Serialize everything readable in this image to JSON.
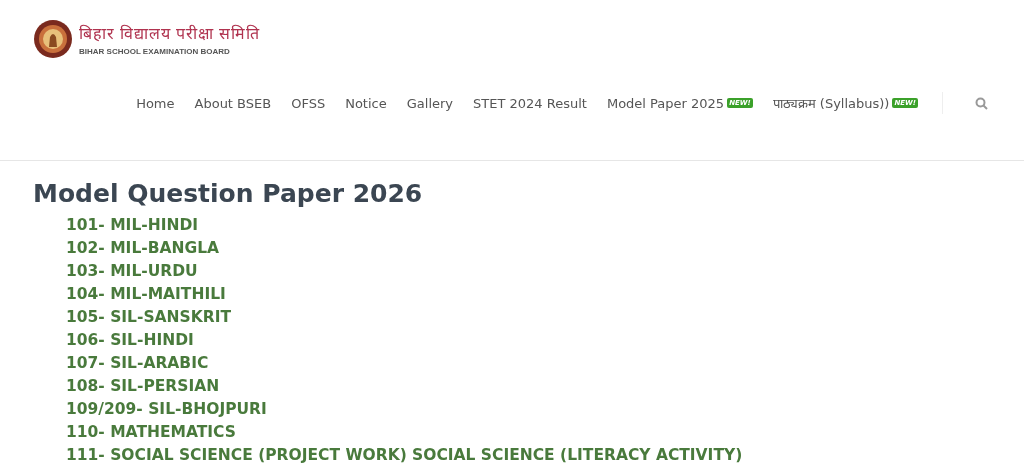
{
  "logo": {
    "title": "बिहार विद्यालय परीक्षा समिति",
    "subtitle": "BIHAR SCHOOL EXAMINATION BOARD"
  },
  "nav": [
    {
      "label": "Home"
    },
    {
      "label": "About BSEB"
    },
    {
      "label": "OFSS"
    },
    {
      "label": "Notice"
    },
    {
      "label": "Gallery"
    },
    {
      "label": "STET 2024 Result"
    },
    {
      "label": "Model Paper 2025",
      "badge": "NEW!"
    },
    {
      "label": "पाठ्यक्रम (Syllabus))",
      "badge": "NEW!"
    }
  ],
  "heading": "Model Question Paper 2026",
  "papers": [
    "101- MIL-HINDI",
    "102- MIL-BANGLA",
    "103- MIL-URDU",
    "104- MIL-MAITHILI",
    "105- SIL-SANSKRIT",
    "106- SIL-HINDI",
    "107- SIL-ARABIC",
    "108- SIL-PERSIAN",
    "109/209- SIL-BHOJPURI",
    "110- MATHEMATICS",
    "111- SOCIAL SCIENCE (PROJECT WORK) SOCIAL SCIENCE (LITERACY ACTIVITY)"
  ]
}
